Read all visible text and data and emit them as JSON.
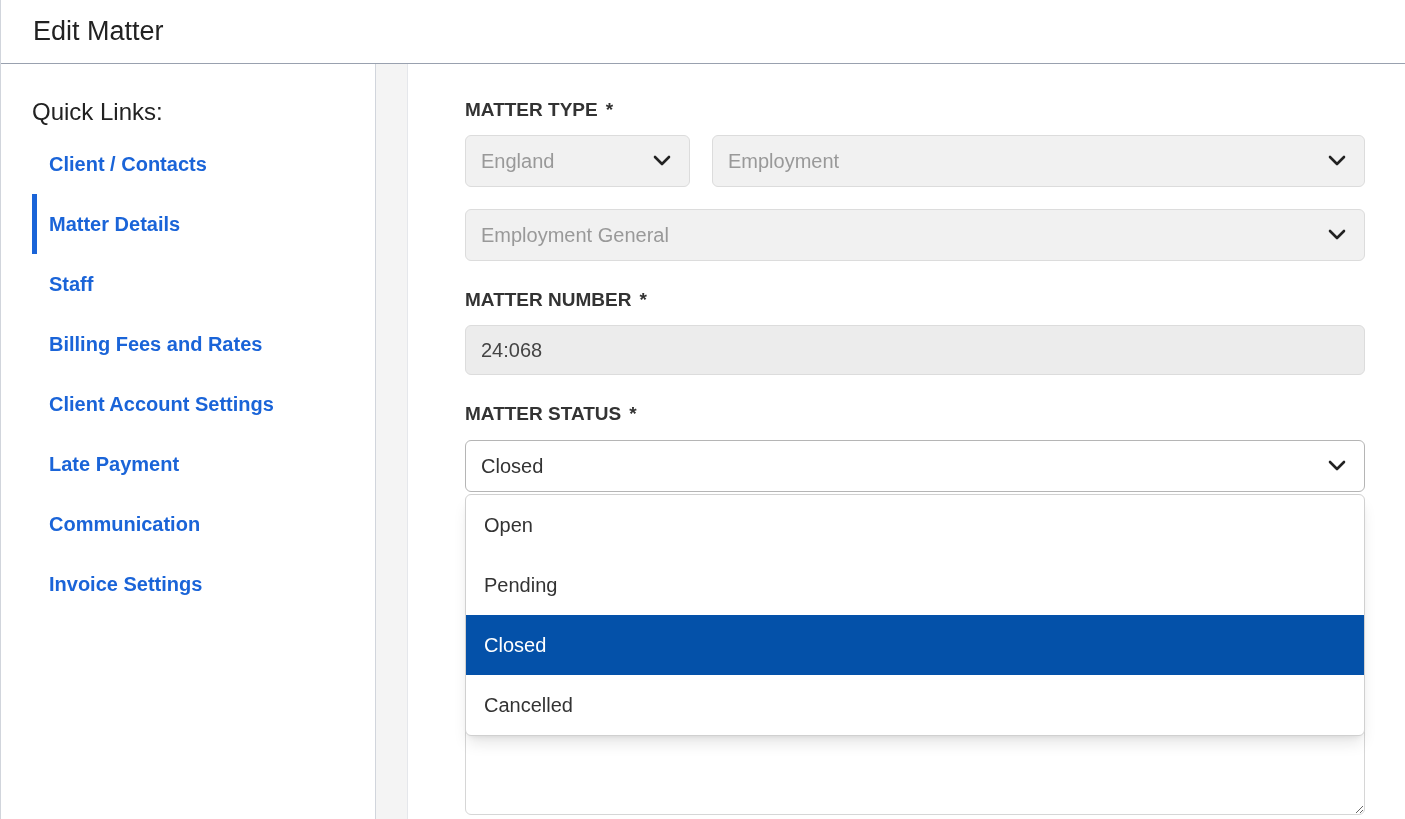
{
  "header": {
    "title": "Edit Matter"
  },
  "sidebar": {
    "heading": "Quick Links:",
    "items": [
      {
        "label": "Client / Contacts",
        "selected": false
      },
      {
        "label": "Matter Details",
        "selected": true
      },
      {
        "label": "Staff",
        "selected": false
      },
      {
        "label": "Billing Fees and Rates",
        "selected": false
      },
      {
        "label": "Client Account Settings",
        "selected": false
      },
      {
        "label": "Late Payment",
        "selected": false
      },
      {
        "label": "Communication",
        "selected": false
      },
      {
        "label": "Invoice Settings",
        "selected": false
      }
    ]
  },
  "matter_type": {
    "label": "MATTER TYPE",
    "required_mark": "*",
    "jurisdiction": {
      "value": "England",
      "disabled": true
    },
    "category": {
      "value": "Employment",
      "disabled": true
    },
    "subcategory": {
      "value": "Employment General",
      "disabled": true
    }
  },
  "matter_number": {
    "label": "MATTER NUMBER",
    "required_mark": "*",
    "value": "24:068"
  },
  "matter_status": {
    "label": "MATTER STATUS",
    "required_mark": "*",
    "value": "Closed",
    "expanded": true,
    "options": [
      {
        "label": "Open",
        "selected": false
      },
      {
        "label": "Pending",
        "selected": false
      },
      {
        "label": "Closed",
        "selected": true
      },
      {
        "label": "Cancelled",
        "selected": false
      }
    ]
  }
}
